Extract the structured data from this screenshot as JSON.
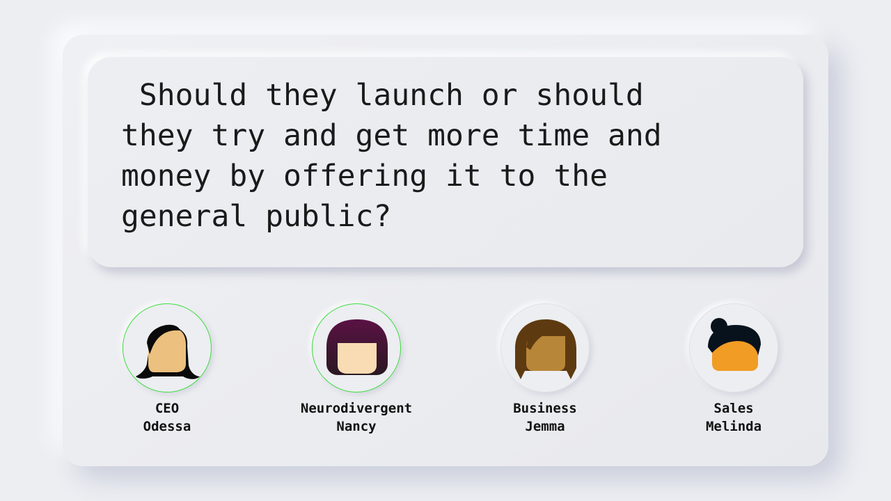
{
  "question": {
    "text": " Should they launch or should\nthey try and get more time and\nmoney by offering it to the\ngeneral public?"
  },
  "people": [
    {
      "role": "CEO",
      "name": "Odessa",
      "active": true,
      "hair_color": "#0a0a0a",
      "skin_color": "#ecc07e"
    },
    {
      "role": "Neurodivergent",
      "name": "Nancy",
      "active": true,
      "hair_color": "#5a1244",
      "skin_color": "#f9dcb3"
    },
    {
      "role": "Business",
      "name": "Jemma",
      "active": false,
      "hair_color": "#5e3a10",
      "skin_color": "#b88638"
    },
    {
      "role": "Sales",
      "name": "Melinda",
      "active": false,
      "hair_color": "#07121c",
      "skin_color": "#f19c24"
    }
  ],
  "colors": {
    "active_ring": "#3cdc3c",
    "background": "#eceef2"
  }
}
